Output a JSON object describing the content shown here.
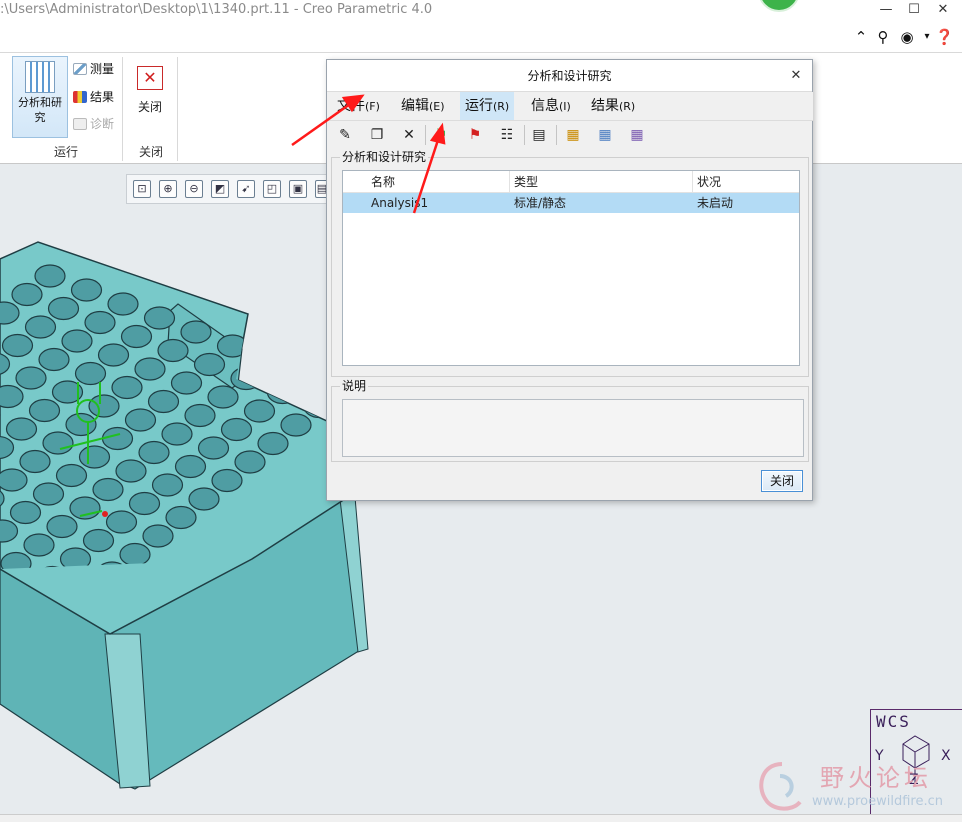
{
  "window": {
    "title": ":\\Users\\Administrator\\Desktop\\1\\1340.prt.11 - Creo Parametric 4.0"
  },
  "ribbon": {
    "analysis_btn_line1": "分析和研",
    "analysis_btn_line2": "究",
    "measure": "测量",
    "results": "结果",
    "diagnose": "诊断",
    "close": "关闭",
    "group_run": "运行",
    "group_close": "关闭"
  },
  "dialog": {
    "title": "分析和设计研究",
    "menus": [
      {
        "label": "文件",
        "accel": "(F)"
      },
      {
        "label": "编辑",
        "accel": "(E)"
      },
      {
        "label": "运行",
        "accel": "(R)"
      },
      {
        "label": "信息",
        "accel": "(I)"
      },
      {
        "label": "结果",
        "accel": "(R)"
      }
    ],
    "group_label": "分析和设计研究",
    "columns": [
      "名称",
      "类型",
      "状况"
    ],
    "rows": [
      {
        "name": "Analysis1",
        "type": "标准/静态",
        "status": "未启动"
      }
    ],
    "description_label": "说明",
    "description_text": "",
    "close_button": "关闭"
  },
  "graphics": {
    "coord_label": "WCS",
    "coord_x": "X",
    "coord_y": "Y",
    "coord_z": "Z"
  },
  "watermark": {
    "title": "野火论坛",
    "url": "www.proewildfire.cn"
  },
  "colors": {
    "model": "#72c4c4",
    "model_edge": "#1f3e44",
    "selection": "#b3dbf5",
    "arrow": "#ff1a1a"
  }
}
